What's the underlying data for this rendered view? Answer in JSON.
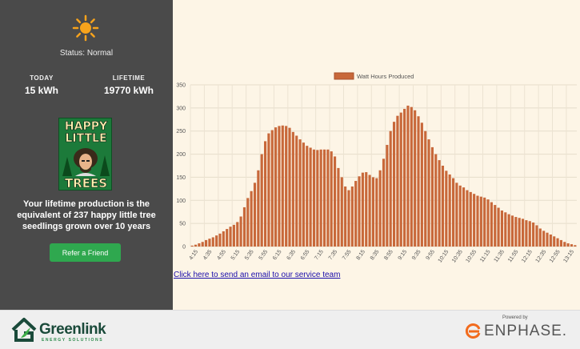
{
  "status": {
    "text": "Status: Normal",
    "icon": "sun-icon",
    "color": "#f7a31c"
  },
  "stats": {
    "today_label": "TODAY",
    "today_value": "15 kWh",
    "lifetime_label": "LIFETIME",
    "lifetime_value": "19770 kWh"
  },
  "poster": {
    "line1": "HAPPY",
    "line2": "LITTLE",
    "line3": "TREES"
  },
  "blurb": "Your lifetime production is the equivalent of 237 happy little tree seedlings grown over 10 years",
  "refer_button": "Refer a Friend",
  "email_link": "Click here to send an email to our service team",
  "footer": {
    "brand_name": "Greenlink",
    "brand_sub": "ENERGY SOLUTIONS",
    "powered_by": "Powered by",
    "enphase": "ENPHASE."
  },
  "colors": {
    "bar": "#c8683a",
    "sidebar": "#4a4a4a",
    "background": "#fdf5e6",
    "button": "#2fa84f"
  },
  "chart_data": {
    "type": "bar",
    "legend": "Watt Hours Produced",
    "legend_position": "top",
    "grid": true,
    "ylim": [
      0,
      350
    ],
    "yticks": [
      0,
      50,
      100,
      150,
      200,
      250,
      300,
      350
    ],
    "x": [
      "4:10",
      "4:15",
      "4:20",
      "4:25",
      "4:30",
      "4:35",
      "4:40",
      "4:45",
      "4:50",
      "4:55",
      "5:00",
      "5:05",
      "5:10",
      "5:15",
      "5:20",
      "5:25",
      "5:30",
      "5:35",
      "5:40",
      "5:45",
      "5:50",
      "5:55",
      "6:00",
      "6:05",
      "6:10",
      "6:15",
      "6:20",
      "6:25",
      "6:30",
      "6:35",
      "6:40",
      "6:45",
      "6:50",
      "6:55",
      "7:00",
      "7:05",
      "7:10",
      "7:15",
      "7:20",
      "7:25",
      "7:30",
      "7:35",
      "7:40",
      "7:45",
      "7:50",
      "7:55",
      "8:00",
      "8:05",
      "8:10",
      "8:15",
      "8:20",
      "8:25",
      "8:30",
      "8:35",
      "8:40",
      "8:45",
      "8:50",
      "8:55",
      "9:00",
      "9:05",
      "9:10",
      "9:15",
      "9:20",
      "9:25",
      "9:30",
      "9:35",
      "9:40",
      "9:45",
      "9:50",
      "9:55",
      "10:00",
      "10:05",
      "10:10",
      "10:15",
      "10:20",
      "10:25",
      "10:30",
      "10:35",
      "10:40",
      "10:45",
      "10:50",
      "10:55",
      "11:00",
      "11:05",
      "11:10",
      "11:15",
      "11:20",
      "11:25",
      "11:30",
      "11:35",
      "11:40",
      "11:45",
      "11:50",
      "11:55",
      "12:00",
      "12:05",
      "12:10",
      "12:15",
      "12:20",
      "12:25",
      "12:30",
      "12:35",
      "12:40",
      "12:45",
      "12:50",
      "12:55",
      "13:00",
      "13:05",
      "13:10",
      "13:15",
      "13:20"
    ],
    "values": [
      2,
      4,
      7,
      10,
      14,
      17,
      20,
      24,
      28,
      33,
      38,
      43,
      47,
      53,
      65,
      85,
      105,
      120,
      138,
      165,
      200,
      228,
      245,
      252,
      258,
      261,
      262,
      261,
      257,
      248,
      240,
      232,
      225,
      218,
      214,
      210,
      209,
      210,
      210,
      210,
      206,
      195,
      170,
      150,
      130,
      122,
      130,
      142,
      152,
      160,
      161,
      155,
      150,
      148,
      165,
      190,
      220,
      250,
      270,
      283,
      290,
      298,
      305,
      302,
      295,
      282,
      268,
      250,
      232,
      215,
      200,
      187,
      175,
      164,
      156,
      148,
      138,
      132,
      128,
      122,
      118,
      114,
      110,
      108,
      106,
      102,
      96,
      90,
      84,
      78,
      74,
      70,
      67,
      64,
      62,
      60,
      57,
      55,
      52,
      46,
      39,
      34,
      30,
      26,
      22,
      18,
      14,
      10,
      7,
      5,
      3
    ]
  }
}
